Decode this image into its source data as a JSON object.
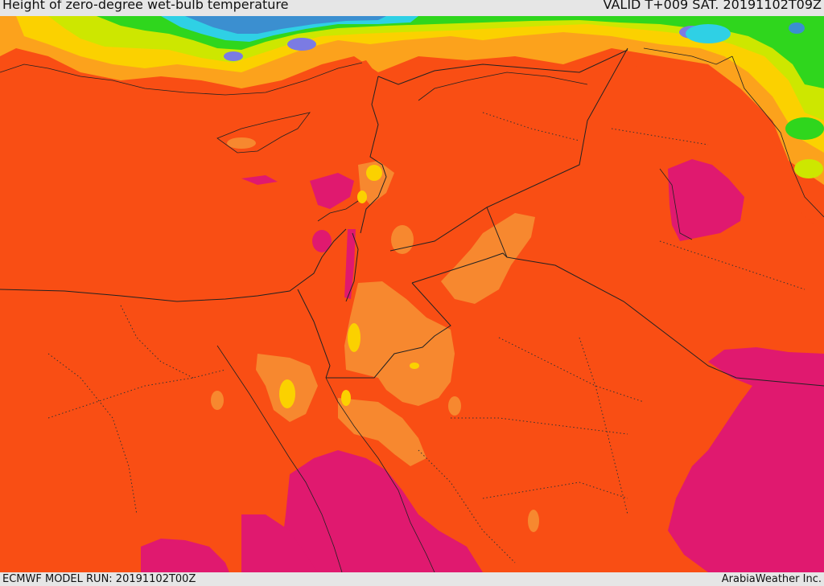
{
  "header": {
    "title": "Height of zero-degree wet-bulb temperature",
    "valid": "VALID T+009 SAT. 20191102T09Z"
  },
  "footer": {
    "model_run": "ECMWF MODEL RUN: 20191102T00Z",
    "credit": "ArabiaWeather Inc."
  },
  "colors": {
    "base_orange_red": "#f94e14",
    "light_orange": "#f7882f",
    "orange": "#fca21c",
    "yellow": "#fbd100",
    "yellow_green": "#cde700",
    "green": "#2fd61d",
    "cyan": "#2fd0e5",
    "blue": "#3b8fd0",
    "violet": "#7b7be3",
    "magenta": "#e0196f",
    "border_line": "#222222"
  }
}
